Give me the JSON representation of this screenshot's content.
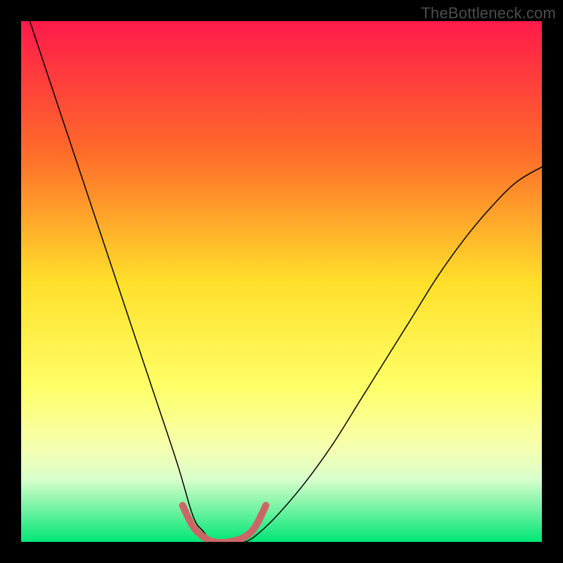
{
  "watermark": "TheBottleneck.com",
  "chart_data": {
    "type": "line",
    "title": "",
    "xlabel": "",
    "ylabel": "",
    "xlim": [
      0,
      100
    ],
    "ylim": [
      0,
      100
    ],
    "gradient_stops": [
      {
        "offset": 0,
        "color": "#ff1a4b"
      },
      {
        "offset": 25,
        "color": "#ff6a2a"
      },
      {
        "offset": 50,
        "color": "#ffdf2a"
      },
      {
        "offset": 70,
        "color": "#ffff66"
      },
      {
        "offset": 82,
        "color": "#f6ffb0"
      },
      {
        "offset": 88,
        "color": "#d9ffcc"
      },
      {
        "offset": 100,
        "color": "#00e676"
      }
    ],
    "series": [
      {
        "name": "bottleneck-curve",
        "stroke": "#000000",
        "stroke_width": 1.5,
        "x": [
          0,
          5,
          10,
          15,
          20,
          25,
          30,
          33,
          35,
          37,
          40,
          43,
          46,
          50,
          55,
          60,
          65,
          70,
          75,
          80,
          85,
          90,
          95,
          100
        ],
        "values": [
          105,
          90,
          75,
          60,
          45,
          30,
          15,
          5,
          2,
          0,
          0,
          0,
          2,
          6,
          12,
          19,
          27,
          35,
          43,
          51,
          58,
          64,
          69,
          72
        ]
      },
      {
        "name": "optimal-band",
        "stroke": "#cc6666",
        "stroke_width": 10,
        "x": [
          31,
          33,
          35,
          37,
          40,
          43,
          45,
          47
        ],
        "values": [
          7,
          3,
          1,
          0,
          0,
          1,
          3,
          7
        ]
      }
    ]
  }
}
